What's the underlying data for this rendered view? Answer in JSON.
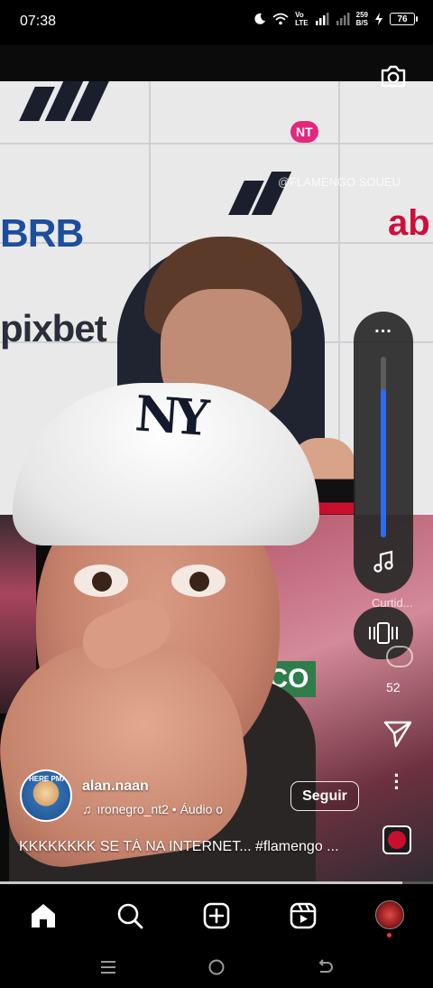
{
  "status_bar": {
    "time": "07:38",
    "net_top": "Vo",
    "net_bottom": "LTE",
    "speed_value": "259",
    "speed_unit": "B/S",
    "battery": "76"
  },
  "video": {
    "watermark": "@FLAMENGO.SOUEU",
    "brand_logo": "NT",
    "sponsor_brb": "BRB",
    "sponsor_pix": "pixbet",
    "sponsor_ab": "ab",
    "sponsor_bet": "bet",
    "overlay_text": "CO",
    "cap_logo": "NY"
  },
  "volume_control": {
    "level_percent": 82,
    "more_icon": "more-horizontal-icon",
    "mode_icon": "music-note-icon"
  },
  "reel_actions": {
    "like_label": "Curtid...",
    "comments_count": "52"
  },
  "post": {
    "username": "alan.naan",
    "audio": "ıronegro_nt2 • Áudio o",
    "follow_label": "Seguir",
    "caption": "KKKKKKKK SE TÁ NA INTERNET... #flamengo ...",
    "avatar_text": "HERE PMA",
    "progress_fraction": 0.93
  },
  "bottom_nav": {
    "items": [
      "home-icon",
      "search-icon",
      "create-icon",
      "reels-icon",
      "profile-avatar"
    ]
  },
  "colors": {
    "volume_fill": "#2d6bf0",
    "notification_dot": "#ff3040"
  }
}
